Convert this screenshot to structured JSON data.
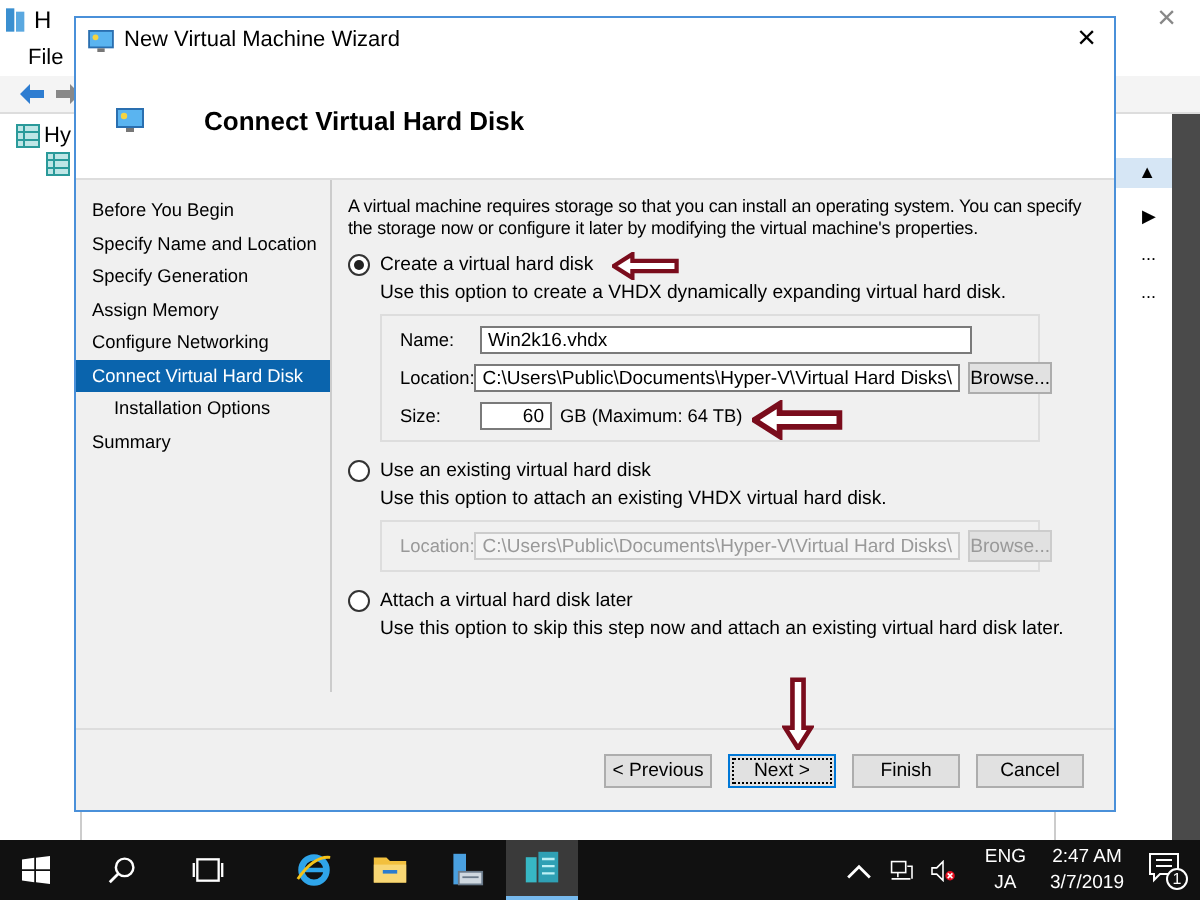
{
  "background_app": {
    "title": "H",
    "menu": [
      "File"
    ],
    "tree": [
      "Hy"
    ],
    "close": "×",
    "right_pane": [
      {
        "text": "▲",
        "selected": true
      },
      {
        "text": "▶",
        "selected": false
      },
      {
        "text": "...",
        "selected": false
      },
      {
        "text": "...",
        "selected": false
      }
    ]
  },
  "wizard": {
    "title": "New Virtual Machine Wizard",
    "close": "×",
    "heading": "Connect Virtual Hard Disk",
    "steps": [
      {
        "label": "Before You Begin",
        "selected": false
      },
      {
        "label": "Specify Name and Location",
        "selected": false
      },
      {
        "label": "Specify Generation",
        "selected": false
      },
      {
        "label": "Assign Memory",
        "selected": false
      },
      {
        "label": "Configure Networking",
        "selected": false
      },
      {
        "label": "Connect Virtual Hard Disk",
        "selected": true,
        "children": [
          {
            "label": "Installation Options",
            "selected": false
          }
        ]
      },
      {
        "label": "Summary",
        "selected": false
      }
    ],
    "intro": "A virtual machine requires storage so that you can install an operating system. You can specify the storage now or configure it later by modifying the virtual machine's properties.",
    "options": [
      {
        "kind": "create",
        "label": "Create a virtual hard disk",
        "selected": true,
        "description": "Use this option to create a VHDX dynamically expanding virtual hard disk.",
        "name_label": "Name:",
        "name_value": "Win2k16.vhdx",
        "location_label": "Location:",
        "location_value": "C:\\Users\\Public\\Documents\\Hyper-V\\Virtual Hard Disks\\",
        "browse": "Browse...",
        "size_label": "Size:",
        "size_value": "60",
        "size_suffix": "GB (Maximum: 64 TB)",
        "disabled": false
      },
      {
        "kind": "existing",
        "label": "Use an existing virtual hard disk",
        "selected": false,
        "description": "Use this option to attach an existing VHDX virtual hard disk.",
        "location_label": "Location:",
        "location_value": "C:\\Users\\Public\\Documents\\Hyper-V\\Virtual Hard Disks\\",
        "browse": "Browse...",
        "disabled": true
      },
      {
        "kind": "later",
        "label": "Attach a virtual hard disk later",
        "selected": false,
        "description": "Use this option to skip this step now and attach an existing virtual hard disk later."
      }
    ],
    "buttons": [
      {
        "label": "< Previous",
        "focused": false
      },
      {
        "label": "Next >",
        "focused": true
      },
      {
        "label": "Finish",
        "focused": false
      },
      {
        "label": "Cancel",
        "focused": false
      }
    ]
  },
  "taskbar": {
    "apps": [
      {
        "kind": "ie",
        "active": false
      },
      {
        "kind": "explorer",
        "active": false
      },
      {
        "kind": "server",
        "active": false
      },
      {
        "kind": "hyperv",
        "active": true
      }
    ],
    "language": [
      "ENG",
      "JA"
    ],
    "time": "2:47 AM",
    "date": "3/7/2019",
    "notifications": "1"
  }
}
